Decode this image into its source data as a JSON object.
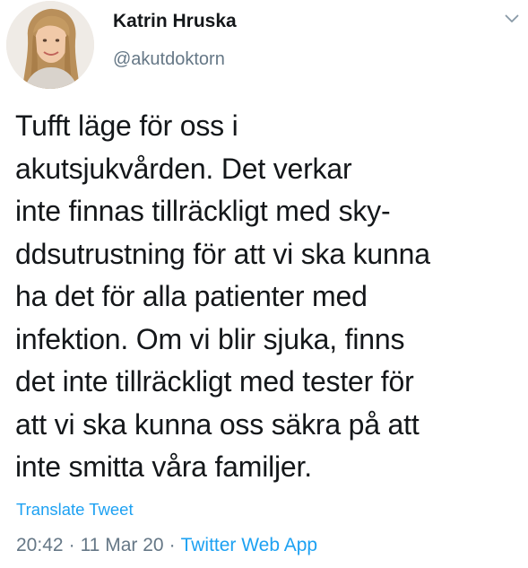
{
  "user": {
    "name": "Katrin Hruska",
    "handle": "@akutdoktorn"
  },
  "icons": {
    "menu": "chevron-down-icon",
    "avatar": "profile-photo"
  },
  "tweet": {
    "text": "Tufft läge för oss i\nakutsjukvården. Det verkar\ninte finnas tillräckligt med sky-\nddsutrustning för att vi ska kunna\nha det för alla patienter med\ninfektion. Om vi blir sjuka, finns\ndet inte tillräckligt med tester för\natt vi ska kunna oss säkra på att\ninte smitta våra familjer.",
    "translate_label": "Translate Tweet"
  },
  "meta": {
    "time": "20:42",
    "separator": "·",
    "date": "11 Mar 20",
    "source": "Twitter Web App"
  },
  "colors": {
    "link": "#1da1f2",
    "secondary": "#657786",
    "primary_text": "#14171a"
  }
}
